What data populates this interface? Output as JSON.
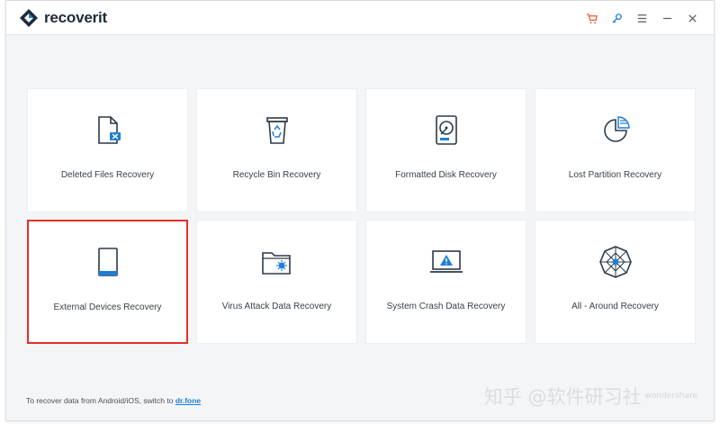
{
  "app": {
    "name": "recoverit",
    "accent": "#1f7fd6",
    "selected_border": "#e0312b"
  },
  "titlebar": {
    "icons": [
      "cart-icon",
      "key-icon",
      "menu-icon",
      "minimize-icon",
      "close-icon"
    ]
  },
  "modes": [
    {
      "label": "Deleted Files Recovery",
      "icon": "deleted-file-icon"
    },
    {
      "label": "Recycle Bin Recovery",
      "icon": "recycle-bin-icon"
    },
    {
      "label": "Formatted Disk Recovery",
      "icon": "formatted-disk-icon"
    },
    {
      "label": "Lost Partition Recovery",
      "icon": "partition-pie-icon"
    },
    {
      "label": "External Devices Recovery",
      "icon": "external-device-icon",
      "selected": true
    },
    {
      "label": "Virus Attack Data Recovery",
      "icon": "virus-folder-icon"
    },
    {
      "label": "System Crash Data Recovery",
      "icon": "system-crash-icon"
    },
    {
      "label": "All - Around Recovery",
      "icon": "all-around-icon"
    }
  ],
  "footer": {
    "text": "To recover data from Android/iOS, switch to ",
    "link": "dr.fone"
  },
  "watermark": {
    "text": "知乎 @软件研习社",
    "small": "wondershare"
  }
}
